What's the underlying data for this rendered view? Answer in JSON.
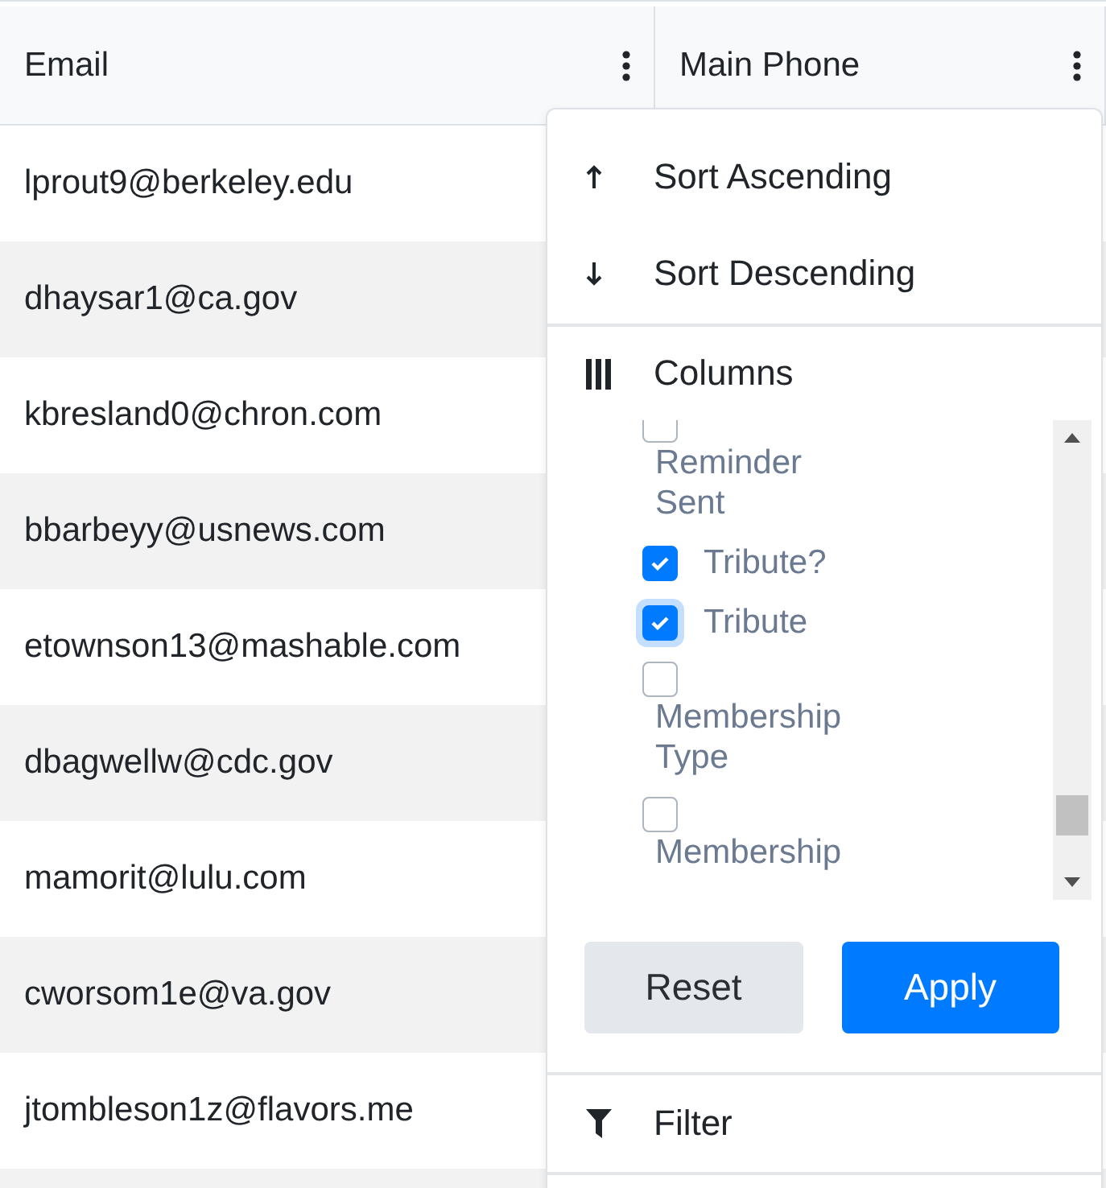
{
  "table": {
    "columns": [
      {
        "label": "Email"
      },
      {
        "label": "Main Phone"
      }
    ],
    "rows": [
      [
        "lprout9@berkeley.edu"
      ],
      [
        "dhaysar1@ca.gov"
      ],
      [
        "kbresland0@chron.com"
      ],
      [
        "bbarbeyy@usnews.com"
      ],
      [
        "etownson13@mashable.com"
      ],
      [
        "dbagwellw@cdc.gov"
      ],
      [
        "mamorit@lulu.com"
      ],
      [
        "cworsom1e@va.gov"
      ],
      [
        "jtombleson1z@flavors.me"
      ],
      [
        ""
      ]
    ]
  },
  "column_menu": {
    "sort_items": [
      {
        "kind": "asc",
        "label": "Sort Ascending"
      },
      {
        "kind": "desc",
        "label": "Sort Descending"
      }
    ],
    "columns_label": "Columns",
    "column_options": [
      {
        "label": "Reminder Sent",
        "checked": false,
        "focused": false
      },
      {
        "label": "Tribute?",
        "checked": true,
        "focused": false
      },
      {
        "label": "Tribute",
        "checked": true,
        "focused": true
      },
      {
        "label": "Membership Type",
        "checked": false,
        "focused": false
      },
      {
        "label": "Membership",
        "checked": false,
        "focused": false
      }
    ],
    "buttons": [
      {
        "kind": "secondary",
        "label": "Reset"
      },
      {
        "kind": "primary",
        "label": "Apply"
      }
    ],
    "filter_label": "Filter"
  }
}
